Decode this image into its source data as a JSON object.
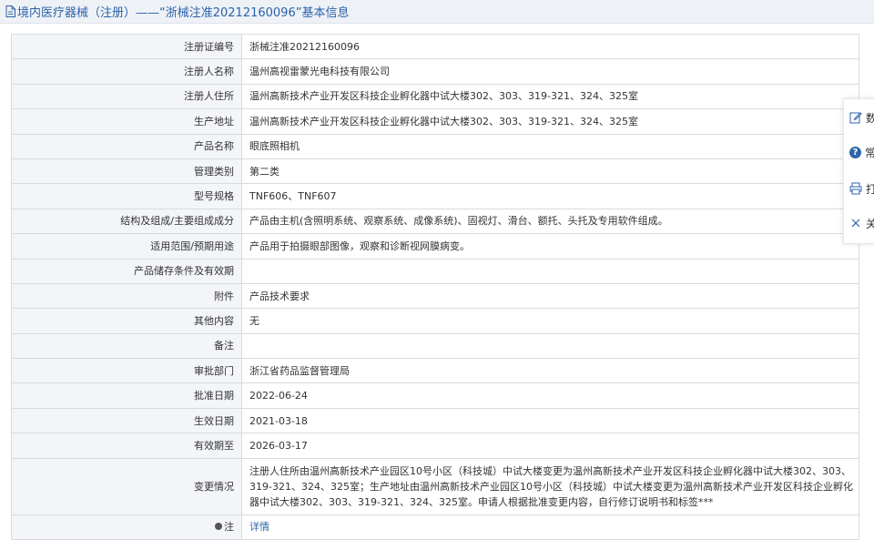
{
  "header": {
    "title": "境内医疗器械（注册）——“浙械注准20212160096”基本信息"
  },
  "rows": [
    {
      "label": "注册证编号",
      "value": "浙械注准20212160096"
    },
    {
      "label": "注册人名称",
      "value": "温州高视雷蒙光电科技有限公司"
    },
    {
      "label": "注册人住所",
      "value": "温州高新技术产业开发区科技企业孵化器中试大楼302、303、319-321、324、325室"
    },
    {
      "label": "生产地址",
      "value": "温州高新技术产业开发区科技企业孵化器中试大楼302、303、319-321、324、325室"
    },
    {
      "label": "产品名称",
      "value": "眼底照相机"
    },
    {
      "label": "管理类别",
      "value": "第二类"
    },
    {
      "label": "型号规格",
      "value": "TNF606、TNF607"
    },
    {
      "label": "结构及组成/主要组成成分",
      "value": "产品由主机(含照明系统、观察系统、成像系统)、固视灯、滑台、额托、头托及专用软件组成。"
    },
    {
      "label": "适用范围/预期用途",
      "value": "产品用于拍摄眼部图像，观察和诊断视网膜病变。"
    },
    {
      "label": "产品储存条件及有效期",
      "value": ""
    },
    {
      "label": "附件",
      "value": "产品技术要求"
    },
    {
      "label": "其他内容",
      "value": "无"
    },
    {
      "label": "备注",
      "value": ""
    },
    {
      "label": "审批部门",
      "value": "浙江省药品监督管理局"
    },
    {
      "label": "批准日期",
      "value": "2022-06-24"
    },
    {
      "label": "生效日期",
      "value": "2021-03-18"
    },
    {
      "label": "有效期至",
      "value": "2026-03-17"
    }
  ],
  "change": {
    "label": "变更情况",
    "value": "注册人住所由温州高新技术产业园区10号小区（科技城）中试大楼变更为温州高新技术产业开发区科技企业孵化器中试大楼302、303、319-321、324、325室；生产地址由温州高新技术产业园区10号小区（科技城）中试大楼变更为温州高新技术产业开发区科技企业孵化器中试大楼302、303、319-321、324、325室。申请人根据批准变更内容，自行修订说明书和标签***"
  },
  "note": {
    "label": "注",
    "link": "详情"
  },
  "float_panel": {
    "items": [
      {
        "label": "数",
        "icon": "edit-icon"
      },
      {
        "label": "常",
        "icon": "question-icon"
      },
      {
        "label": "打",
        "icon": "print-icon"
      },
      {
        "label": "关",
        "icon": "close-icon"
      }
    ]
  },
  "colors": {
    "accent": "#2c64a8",
    "label_bg": "#f3f5f8",
    "border": "#d7dbe2",
    "header_bg": "#eef1f6"
  }
}
